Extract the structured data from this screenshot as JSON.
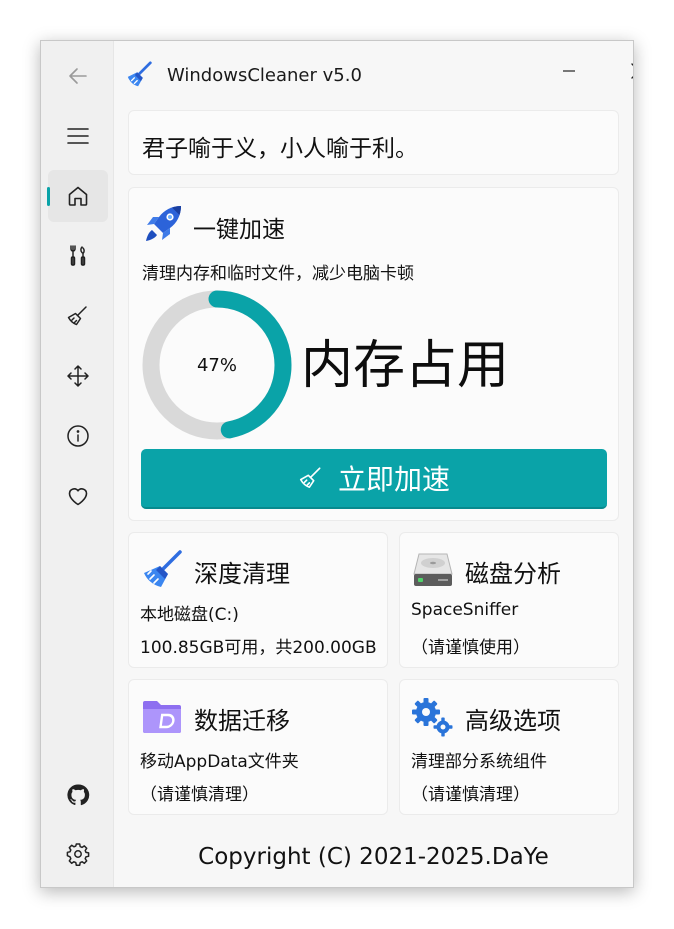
{
  "window": {
    "title": "WindowsCleaner v5.0",
    "accent_color": "#0aa3a8"
  },
  "sidebar": {
    "items": [
      {
        "name": "back",
        "icon": "back-arrow-icon"
      },
      {
        "name": "menu",
        "icon": "hamburger-menu-icon"
      },
      {
        "name": "home",
        "icon": "home-icon",
        "active": true
      },
      {
        "name": "tools",
        "icon": "tools-icon"
      },
      {
        "name": "clean",
        "icon": "broom-icon"
      },
      {
        "name": "move",
        "icon": "move-arrows-icon"
      },
      {
        "name": "about",
        "icon": "info-icon"
      },
      {
        "name": "favorite",
        "icon": "heart-icon"
      },
      {
        "name": "github",
        "icon": "github-icon"
      },
      {
        "name": "settings",
        "icon": "gear-icon"
      }
    ]
  },
  "quote": {
    "text": "君子喻于义，小人喻于利。"
  },
  "accelerate": {
    "title": "一键加速",
    "subtitle": "清理内存和临时文件，减少电脑卡顿",
    "memory_percent": 47,
    "memory_percent_label": "47%",
    "memory_label": "内存占用",
    "button_label": "立即加速"
  },
  "tiles": {
    "deep_clean": {
      "title": "深度清理",
      "line1": "本地磁盘(C:)",
      "line2": "100.85GB可用，共200.00GB"
    },
    "disk_analysis": {
      "title": "磁盘分析",
      "line1": "SpaceSniffer",
      "line2": "（请谨慎使用）"
    },
    "data_migration": {
      "title": "数据迁移",
      "line1": "移动AppData文件夹",
      "line2": "（请谨慎清理）"
    },
    "advanced": {
      "title": "高级选项",
      "line1": "清理部分系统组件",
      "line2": "（请谨慎清理）"
    }
  },
  "footer": {
    "copyright": "Copyright (C) 2021-2025.DaYe"
  }
}
